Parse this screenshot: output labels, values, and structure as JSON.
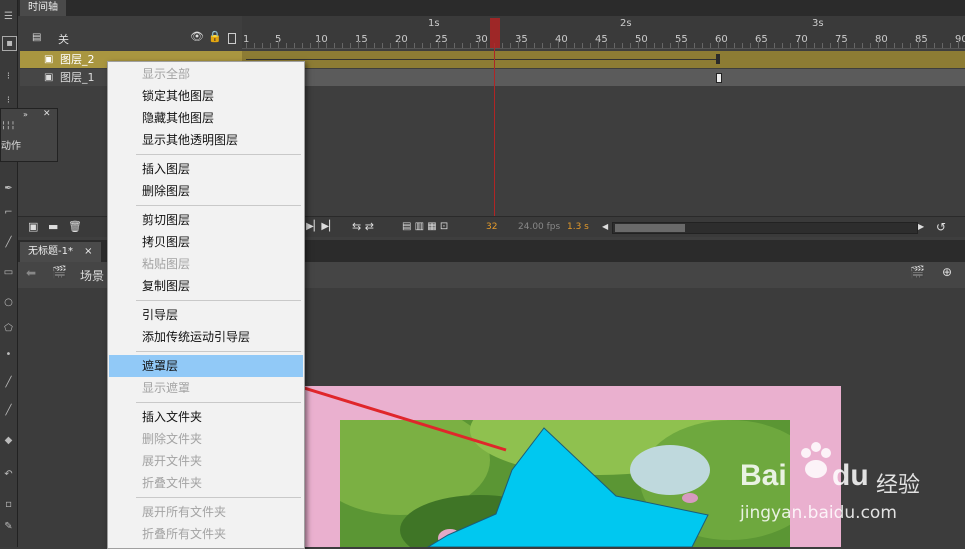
{
  "timeline": {
    "tab_label": "时间轴",
    "header_label": "关",
    "seconds": [
      "1s",
      "2s",
      "3s"
    ],
    "frame_numbers": [
      "1",
      "5",
      "10",
      "15",
      "20",
      "25",
      "30",
      "35",
      "40",
      "45",
      "50",
      "55",
      "60",
      "65",
      "70",
      "75",
      "80",
      "85",
      "90"
    ],
    "layers": [
      {
        "name": "图层_2",
        "selected": true
      },
      {
        "name": "图层_1",
        "selected": false
      }
    ],
    "current_frame": "32",
    "fps": "24.00 fps",
    "time": "1.3 s"
  },
  "actions_panel": {
    "title": "动作"
  },
  "document": {
    "tab_label": "无标题-1*",
    "close_glyph": "×",
    "scene_label": "场景"
  },
  "context_menu": {
    "items": [
      {
        "label": "显示全部",
        "disabled": true
      },
      {
        "label": "锁定其他图层",
        "disabled": false
      },
      {
        "label": "隐藏其他图层",
        "disabled": false
      },
      {
        "label": "显示其他透明图层",
        "disabled": false
      },
      {
        "label": "插入图层",
        "disabled": false
      },
      {
        "label": "删除图层",
        "disabled": false
      },
      {
        "label": "剪切图层",
        "disabled": false
      },
      {
        "label": "拷贝图层",
        "disabled": false
      },
      {
        "label": "粘贴图层",
        "disabled": true
      },
      {
        "label": "复制图层",
        "disabled": false
      },
      {
        "label": "引导层",
        "disabled": false
      },
      {
        "label": "添加传统运动引导层",
        "disabled": false
      },
      {
        "label": "遮罩层",
        "disabled": false,
        "highlighted": true
      },
      {
        "label": "显示遮罩",
        "disabled": true
      },
      {
        "label": "插入文件夹",
        "disabled": false
      },
      {
        "label": "删除文件夹",
        "disabled": true
      },
      {
        "label": "展开文件夹",
        "disabled": true
      },
      {
        "label": "折叠文件夹",
        "disabled": true
      },
      {
        "label": "展开所有文件夹",
        "disabled": true
      },
      {
        "label": "折叠所有文件夹",
        "disabled": true
      }
    ]
  },
  "watermark": {
    "brand_left": "Bai",
    "brand_right": "du",
    "brand_cn": "经验",
    "url": "jingyan.baidu.com"
  },
  "colors": {
    "accent_arrow": "#e0262b",
    "menu_highlight": "#91c9f7",
    "stage_bg": "#eab0cf",
    "mask_shape": "#00c8f0",
    "playhead": "#b02525",
    "selected_layer": "#a99640"
  }
}
